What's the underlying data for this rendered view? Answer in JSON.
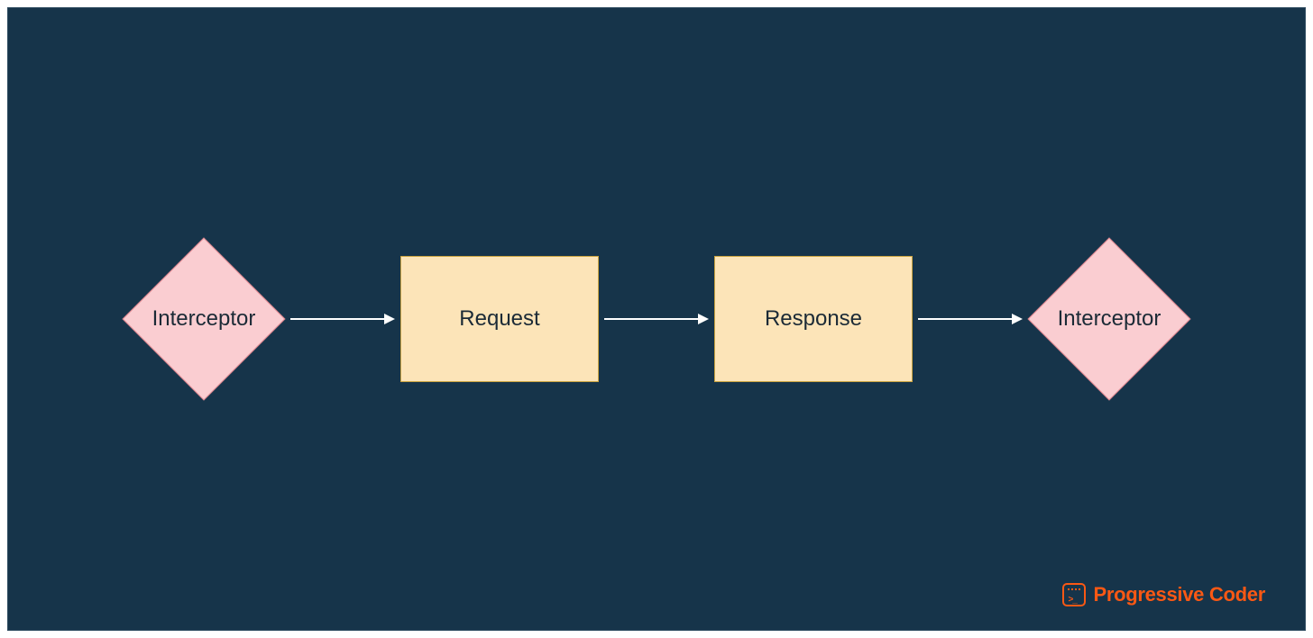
{
  "diagram": {
    "nodes": {
      "interceptor_left": {
        "label": "Interceptor",
        "shape": "diamond",
        "fill": "#facdd1",
        "stroke": "#db808a"
      },
      "request": {
        "label": "Request",
        "shape": "rectangle",
        "fill": "#fce4b8",
        "stroke": "#c9a33f"
      },
      "response": {
        "label": "Response",
        "shape": "rectangle",
        "fill": "#fce4b8",
        "stroke": "#c9a33f"
      },
      "interceptor_right": {
        "label": "Interceptor",
        "shape": "diamond",
        "fill": "#facdd1",
        "stroke": "#db808a"
      }
    },
    "flow": [
      "interceptor_left",
      "request",
      "response",
      "interceptor_right"
    ]
  },
  "branding": {
    "name": "Progressive Coder",
    "accent": "#fa5814"
  },
  "canvas": {
    "background": "#16344a"
  }
}
